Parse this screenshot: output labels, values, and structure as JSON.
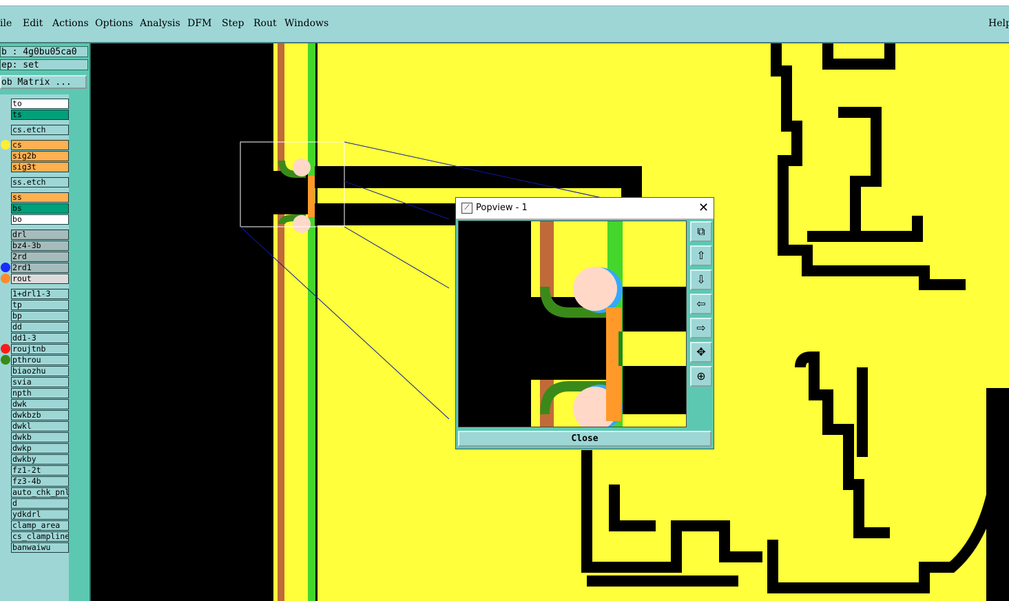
{
  "menu": [
    "ile",
    "Edit",
    "Actions",
    "Options",
    "Analysis",
    "DFM",
    "Step",
    "Rout",
    "Windows"
  ],
  "menu_help": "Help",
  "job_label": "b : 4g0bu05ca0",
  "step_label": "ep: set",
  "job_matrix_button": "ob Matrix ...",
  "layers": [
    {
      "name": "to",
      "bg": "#ffffff"
    },
    {
      "name": "ts",
      "bg": "#00a07a"
    },
    {
      "name": "cs.etch",
      "bg": "#9ed6d6"
    },
    {
      "name": "cs",
      "bg": "#ffb050",
      "dot": "#ffee33"
    },
    {
      "name": "sig2b",
      "bg": "#ffb050"
    },
    {
      "name": "sig3t",
      "bg": "#ffb050"
    },
    {
      "name": "ss.etch",
      "bg": "#9ed6d6"
    },
    {
      "name": "ss",
      "bg": "#ffb050"
    },
    {
      "name": "bs",
      "bg": "#00a07a"
    },
    {
      "name": "bo",
      "bg": "#ffffff"
    },
    {
      "name": "drl",
      "bg": "#a6bcbc"
    },
    {
      "name": "bz4-3b",
      "bg": "#a6bcbc"
    },
    {
      "name": "2rd",
      "bg": "#a6bcbc"
    },
    {
      "name": "2rd1",
      "bg": "#a6bcbc",
      "dot": "#1a2cff"
    },
    {
      "name": "rout",
      "bg": "#dcdcdc",
      "dot": "#ff8a2a"
    },
    {
      "name": "1+drl1-3",
      "bg": "#9ed6d6"
    },
    {
      "name": "tp",
      "bg": "#9ed6d6"
    },
    {
      "name": "bp",
      "bg": "#9ed6d6"
    },
    {
      "name": "dd",
      "bg": "#9ed6d6"
    },
    {
      "name": "dd1-3",
      "bg": "#9ed6d6"
    },
    {
      "name": "roujtnb",
      "bg": "#9ed6d6",
      "dot": "#ff1a1a"
    },
    {
      "name": "pthrou",
      "bg": "#9ed6d6",
      "dot": "#3a8a1a"
    },
    {
      "name": "biaozhu",
      "bg": "#9ed6d6"
    },
    {
      "name": "svia",
      "bg": "#9ed6d6"
    },
    {
      "name": "npth",
      "bg": "#9ed6d6"
    },
    {
      "name": "dwk",
      "bg": "#9ed6d6"
    },
    {
      "name": "dwkbzb",
      "bg": "#9ed6d6"
    },
    {
      "name": "dwkl",
      "bg": "#9ed6d6"
    },
    {
      "name": "dwkb",
      "bg": "#9ed6d6"
    },
    {
      "name": "dwkp",
      "bg": "#9ed6d6"
    },
    {
      "name": "dwkby",
      "bg": "#9ed6d6"
    },
    {
      "name": "fz1-2t",
      "bg": "#9ed6d6"
    },
    {
      "name": "fz3-4b",
      "bg": "#9ed6d6"
    },
    {
      "name": "auto_chk_pnl",
      "bg": "#9ed6d6"
    },
    {
      "name": "d",
      "bg": "#9ed6d6"
    },
    {
      "name": "ydkdrl",
      "bg": "#9ed6d6"
    },
    {
      "name": "clamp_area",
      "bg": "#9ed6d6"
    },
    {
      "name": "cs_clampline",
      "bg": "#9ed6d6"
    },
    {
      "name": "banwaiwu",
      "bg": "#9ed6d6"
    }
  ],
  "popview": {
    "title": "Popview - 1",
    "close_button": "Close",
    "tools": [
      "zoom-fit-icon",
      "pan-up-icon",
      "pan-down-icon",
      "pan-left-icon",
      "pan-right-icon",
      "zoom-in-icon",
      "zoom-out-icon"
    ]
  },
  "colors": {
    "menubar": "#9ed6d6",
    "panel": "#5cc8b2",
    "copper": "#ffff3c",
    "board": "#000000",
    "rout_line": "#c06a3a",
    "green_line": "#44d62a"
  }
}
